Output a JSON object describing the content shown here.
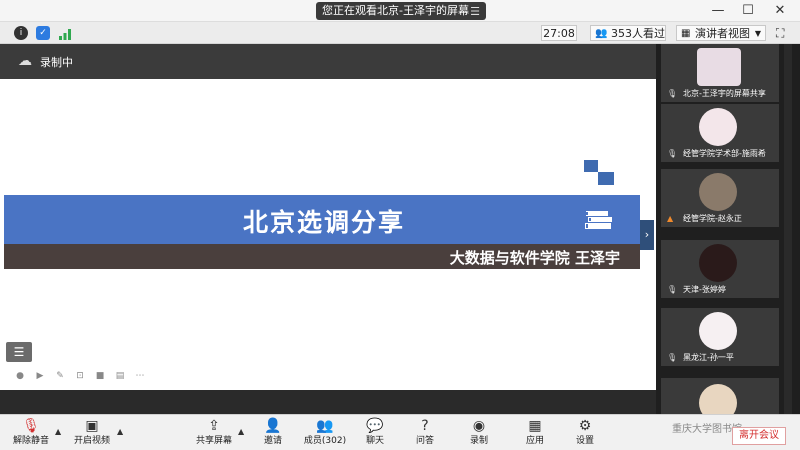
{
  "titlebar": {
    "share_status": "您正在观看北京-王泽宇的屏幕",
    "menu_icon": "hamburger-icon",
    "minimize": "—",
    "maximize": "☐",
    "close": "✕"
  },
  "infobar": {
    "timer": "27:08",
    "viewers": "353人看过",
    "view_mode": "演讲者视图"
  },
  "share": {
    "recording_label": "录制中",
    "slide_title": "北京选调分享",
    "slide_subtitle": "大数据与软件学院 王泽宇"
  },
  "participants": [
    {
      "name": "北京-王泽宇的屏幕共享"
    },
    {
      "name": "经管学院学术部-施雨希"
    },
    {
      "name": "经管学院-赵永正"
    },
    {
      "name": "天津-张婷婷"
    },
    {
      "name": "黑龙江-孙一平"
    },
    {
      "name": ""
    }
  ],
  "toolbar": {
    "unmute": "解除静音",
    "start_video": "开启视频",
    "share_screen": "共享屏幕",
    "invite": "邀请",
    "members": "成员(302)",
    "chat": "聊天",
    "qa": "问答",
    "record": "录制",
    "apps": "应用",
    "settings": "设置",
    "leave": "离开会议",
    "watermark": "重庆大学图书馆"
  },
  "colors": {
    "slide_blue": "#4a74c4",
    "slide_brown": "#4a3f3d",
    "leave_red": "#d32f2f"
  }
}
